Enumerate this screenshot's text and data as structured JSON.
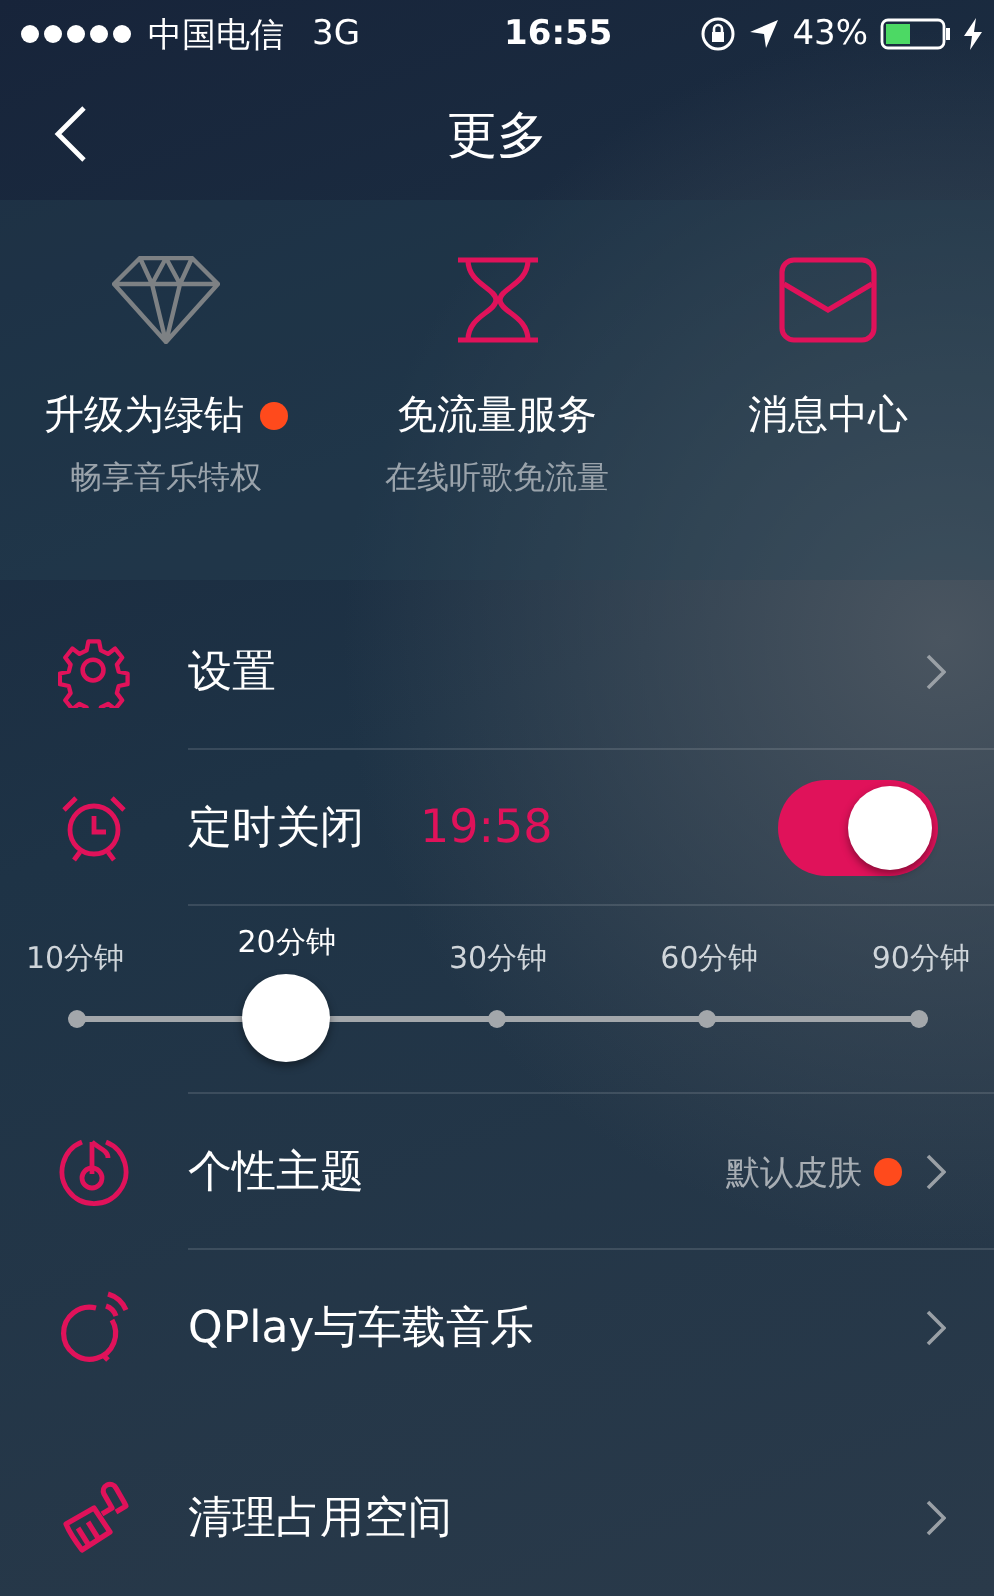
{
  "status_bar": {
    "carrier": "中国电信",
    "network": "3G",
    "time": "16:55",
    "battery": "43%"
  },
  "nav": {
    "title": "更多"
  },
  "features": [
    {
      "title": "升级为绿钻",
      "subtitle": "畅享音乐特权",
      "badge": true
    },
    {
      "title": "免流量服务",
      "subtitle": "在线听歌免流量"
    },
    {
      "title": "消息中心"
    }
  ],
  "sections": [
    {
      "rows": [
        {
          "kind": "link",
          "label": "设置"
        },
        {
          "kind": "toggle",
          "label": "定时关闭",
          "value": "19:58",
          "on": true
        },
        {
          "kind": "slider",
          "level": 0.25,
          "stops": [
            {
              "label": "10分钟",
              "selected": false
            },
            {
              "label": "20分钟",
              "selected": true
            },
            {
              "label": "30分钟",
              "selected": false
            },
            {
              "label": "60分钟",
              "selected": false
            },
            {
              "label": "90分钟",
              "selected": false
            }
          ]
        },
        {
          "kind": "link",
          "label": "个性主题",
          "detail": "默认皮肤",
          "badge": true
        },
        {
          "kind": "link",
          "label": "QPlay与车载音乐"
        }
      ]
    },
    {
      "rows": [
        {
          "kind": "link",
          "label": "清理占用空间"
        }
      ]
    }
  ]
}
